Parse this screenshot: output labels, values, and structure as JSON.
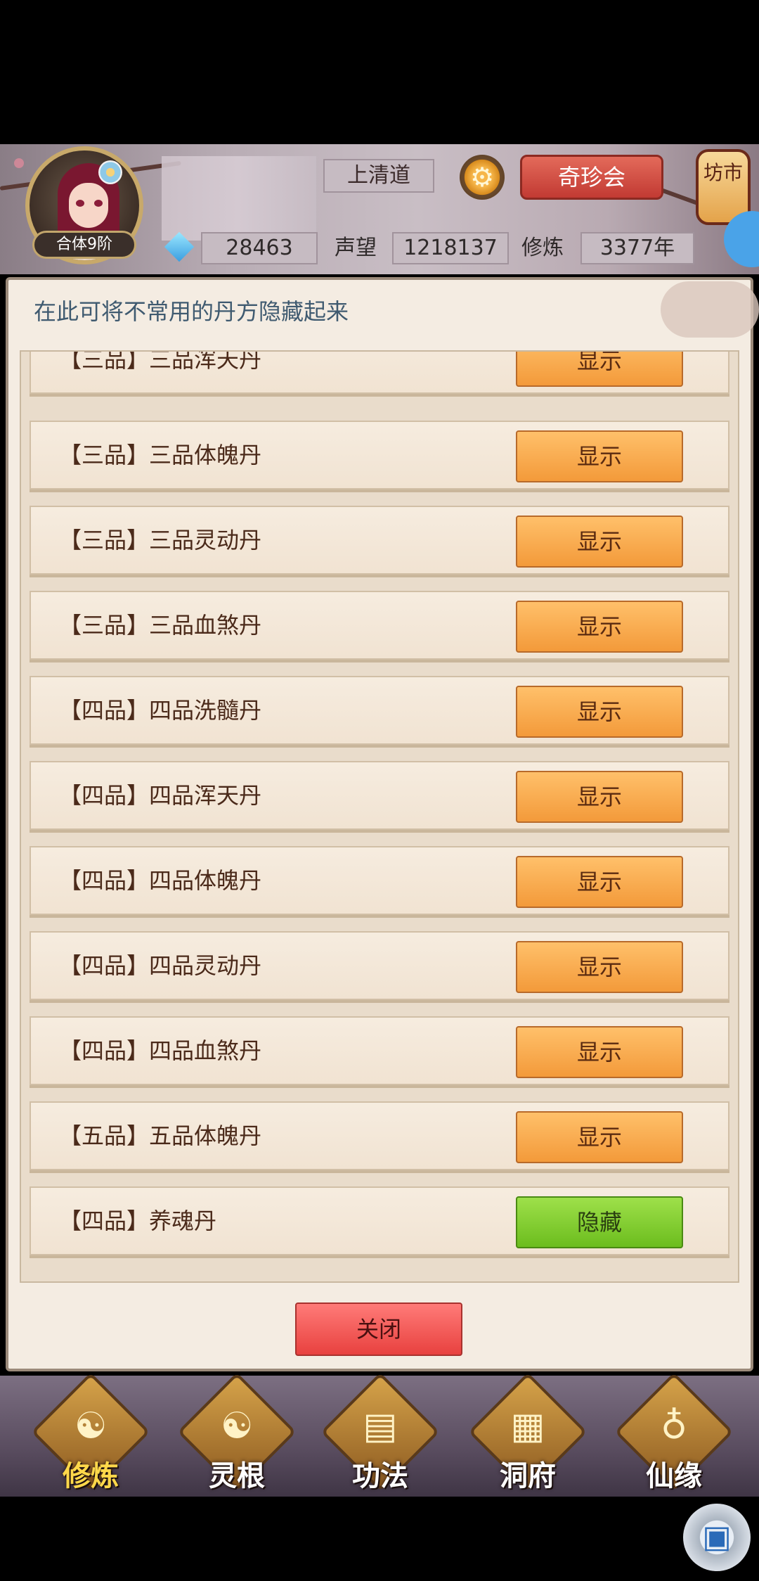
{
  "header": {
    "rank_badge": "合体9阶",
    "sect_name": "上清道",
    "settings_icon": "gear-icon",
    "treasure_button": "奇珍会",
    "market_lantern": "坊市",
    "spirit_stones": "28463",
    "reputation_label": "声望",
    "reputation_value": "1218137",
    "cultivation_label": "修炼",
    "cultivation_value": "3377年"
  },
  "panel": {
    "instruction": "在此可将不常用的丹方隐藏起来",
    "rows": [
      {
        "grade": "【三品】",
        "name": "三品浑天丹",
        "button": "显示",
        "state": "show"
      },
      {
        "grade": "【三品】",
        "name": "三品体魄丹",
        "button": "显示",
        "state": "show"
      },
      {
        "grade": "【三品】",
        "name": "三品灵动丹",
        "button": "显示",
        "state": "show"
      },
      {
        "grade": "【三品】",
        "name": "三品血煞丹",
        "button": "显示",
        "state": "show"
      },
      {
        "grade": "【四品】",
        "name": "四品洗髓丹",
        "button": "显示",
        "state": "show"
      },
      {
        "grade": "【四品】",
        "name": "四品浑天丹",
        "button": "显示",
        "state": "show"
      },
      {
        "grade": "【四品】",
        "name": "四品体魄丹",
        "button": "显示",
        "state": "show"
      },
      {
        "grade": "【四品】",
        "name": "四品灵动丹",
        "button": "显示",
        "state": "show"
      },
      {
        "grade": "【四品】",
        "name": "四品血煞丹",
        "button": "显示",
        "state": "show"
      },
      {
        "grade": "【五品】",
        "name": "五品体魄丹",
        "button": "显示",
        "state": "show"
      },
      {
        "grade": "【四品】",
        "name": "养魂丹",
        "button": "隐藏",
        "state": "hide"
      }
    ],
    "close_button": "关闭"
  },
  "bottom_nav": [
    {
      "label": "修炼",
      "icon": "meditating-monk-icon",
      "active": true
    },
    {
      "label": "灵根",
      "icon": "yin-yang-sword-icon",
      "active": false
    },
    {
      "label": "功法",
      "icon": "scroll-book-icon",
      "active": false
    },
    {
      "label": "洞府",
      "icon": "golden-temple-icon",
      "active": false
    },
    {
      "label": "仙缘",
      "icon": "gourd-icon",
      "active": false
    }
  ],
  "floating_button_icon": "cube-icon",
  "colors": {
    "show_button": "#f39a3a",
    "hide_button": "#6cbd1e",
    "close_button": "#e8413f",
    "instruction_text": "#3f5a70"
  }
}
